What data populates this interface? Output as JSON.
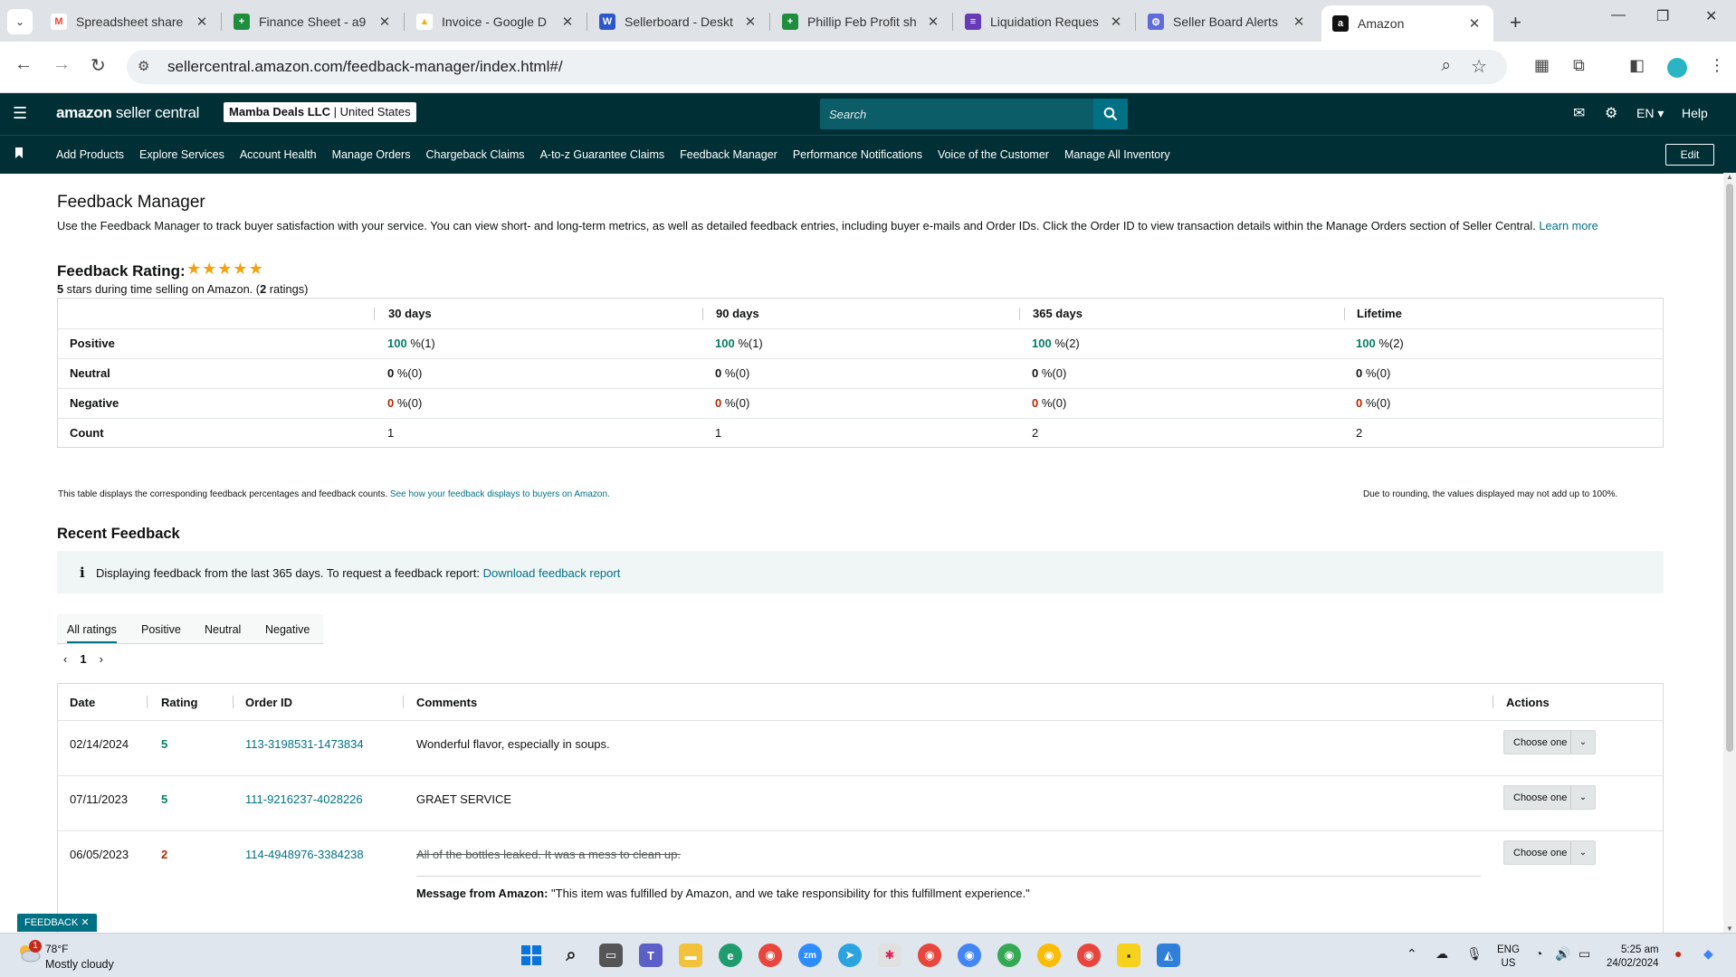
{
  "browser": {
    "tabs": [
      {
        "title": "Spreadsheet share",
        "icon": "gmail-icon",
        "glyph": "M",
        "color": "#ea4335"
      },
      {
        "title": "Finance Sheet - a9",
        "icon": "google-sheets-icon",
        "glyph": "+",
        "color": "#1e8e3e"
      },
      {
        "title": "Invoice - Google D",
        "icon": "google-drive-icon",
        "glyph": "▲",
        "color": "#f4b400"
      },
      {
        "title": "Sellerboard - Deskt",
        "icon": "sellerboard-icon",
        "glyph": "W",
        "color": "#2d59c8"
      },
      {
        "title": "Phillip Feb Profit sh",
        "icon": "google-sheets-icon",
        "glyph": "+",
        "color": "#1e8e3e"
      },
      {
        "title": "Liquidation Reques",
        "icon": "google-forms-icon",
        "glyph": "≡",
        "color": "#673ab7"
      },
      {
        "title": "Seller Board Alerts",
        "icon": "settings-app-icon",
        "glyph": "⚙",
        "color": "#5f6bd8"
      },
      {
        "title": "Amazon",
        "icon": "amazon-icon",
        "glyph": "a",
        "color": "#111111"
      }
    ],
    "url": "sellercentral.amazon.com/feedback-manager/index.html#/"
  },
  "header": {
    "brand_bold": "amazon",
    "brand_rest": " seller central",
    "account_name": "Mamba Deals LLC",
    "account_region": " | United States",
    "search_placeholder": "Search",
    "language": "EN ▾",
    "help": "Help"
  },
  "nav": {
    "items": [
      "Add Products",
      "Explore Services",
      "Account Health",
      "Manage Orders",
      "Chargeback Claims",
      "A-to-z Guarantee Claims",
      "Feedback Manager",
      "Performance Notifications",
      "Voice of the Customer",
      "Manage All Inventory"
    ],
    "edit": "Edit"
  },
  "page": {
    "title": "Feedback Manager",
    "description": "Use the Feedback Manager to track buyer satisfaction with your service. You can view short- and long-term metrics, as well as detailed feedback entries, including buyer e-mails and Order IDs. Click the Order ID to view transaction details within the Manage Orders section of Seller Central.",
    "learn_more": "Learn more",
    "rating_title": "Feedback Rating:",
    "stars": 5,
    "rating_stars_value": "5",
    "rating_sub_mid": " stars during time selling on Amazon. (",
    "rating_count": "2",
    "rating_sub_end": " ratings)"
  },
  "rating_table": {
    "columns": [
      "",
      "30 days",
      "90 days",
      "365 days",
      "Lifetime"
    ],
    "rows": [
      {
        "label": "Positive",
        "cells": [
          [
            "100",
            " %(1)"
          ],
          [
            "100",
            " %(1)"
          ],
          [
            "100",
            " %(2)"
          ],
          [
            "100",
            " %(2)"
          ]
        ]
      },
      {
        "label": "Neutral",
        "cells": [
          [
            "0",
            " %(0)"
          ],
          [
            "0",
            " %(0)"
          ],
          [
            "0",
            " %(0)"
          ],
          [
            "0",
            " %(0)"
          ]
        ]
      },
      {
        "label": "Negative",
        "cells": [
          [
            "0",
            " %(0)"
          ],
          [
            "0",
            " %(0)"
          ],
          [
            "0",
            " %(0)"
          ],
          [
            "0",
            " %(0)"
          ]
        ]
      },
      {
        "label": "Count",
        "cells": [
          [
            "",
            "1"
          ],
          [
            "",
            "1"
          ],
          [
            "",
            "2"
          ],
          [
            "",
            "2"
          ]
        ]
      }
    ],
    "note_left": "This table displays the corresponding feedback percentages and feedback counts.",
    "note_link": "See how your feedback displays to buyers on Amazon.",
    "note_right": "Due to rounding, the values displayed may not add up to 100%."
  },
  "recent": {
    "title": "Recent Feedback",
    "info_text": "Displaying feedback from the last 365 days. To request a feedback report:",
    "info_link": "Download feedback report",
    "tabs": [
      "All ratings",
      "Positive",
      "Neutral",
      "Negative"
    ],
    "page": "1",
    "columns": [
      "Date",
      "Rating",
      "Order ID",
      "Comments",
      "Actions"
    ],
    "rows": [
      {
        "date": "02/14/2024",
        "rating": "5",
        "order_id": "113-3198531-1473834",
        "comment": "Wonderful flavor, especially in soups.",
        "action": "Choose one"
      },
      {
        "date": "07/11/2023",
        "rating": "5",
        "order_id": "111-9216237-4028226",
        "comment": "GRAET SERVICE",
        "action": "Choose one"
      },
      {
        "date": "06/05/2023",
        "rating": "2",
        "order_id": "114-4948976-3384238",
        "comment": "All of the bottles leaked. It was a mess to clean up.",
        "action": "Choose one",
        "amazon_label": "Message from Amazon:",
        "amazon_message": " \"This item was fulfilled by Amazon, and we take responsibility for this fulfillment experience.\""
      }
    ],
    "feedback_pill": "FEEDBACK ✕"
  },
  "taskbar": {
    "weather_badge": "1",
    "temperature": "78°F",
    "condition": "Mostly cloudy",
    "lang_top": "ENG",
    "lang_bottom": "US",
    "time": "5:25 am",
    "date": "24/02/2024"
  }
}
